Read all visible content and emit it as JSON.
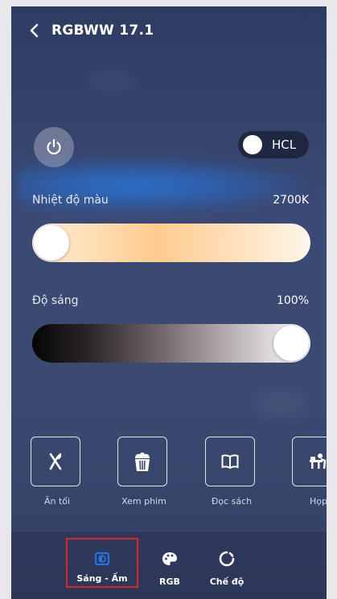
{
  "header": {
    "title": "RGBWW 17.1"
  },
  "controls": {
    "hcl_label": "HCL"
  },
  "color_temp": {
    "label": "Nhiệt độ màu",
    "value": "2700K",
    "level": 0.0
  },
  "brightness": {
    "label": "Độ sáng",
    "value": "100%",
    "level": 1.0
  },
  "scenes": [
    {
      "label": "Ăn tối",
      "icon": "dinner-icon"
    },
    {
      "label": "Xem phim",
      "icon": "popcorn-icon"
    },
    {
      "label": "Đọc sách",
      "icon": "book-icon"
    },
    {
      "label": "Họp",
      "icon": "meeting-icon"
    }
  ],
  "tabs": [
    {
      "label": "Sáng - Ấm",
      "icon": "brightness-icon",
      "selected": true
    },
    {
      "label": "RGB",
      "icon": "palette-icon",
      "selected": false
    },
    {
      "label": "Chế độ",
      "icon": "mode-icon",
      "selected": false
    }
  ],
  "colors": {
    "accent_selected": "#1e78e6",
    "highlight_box": "#d82828",
    "background": "#3b4a74"
  }
}
